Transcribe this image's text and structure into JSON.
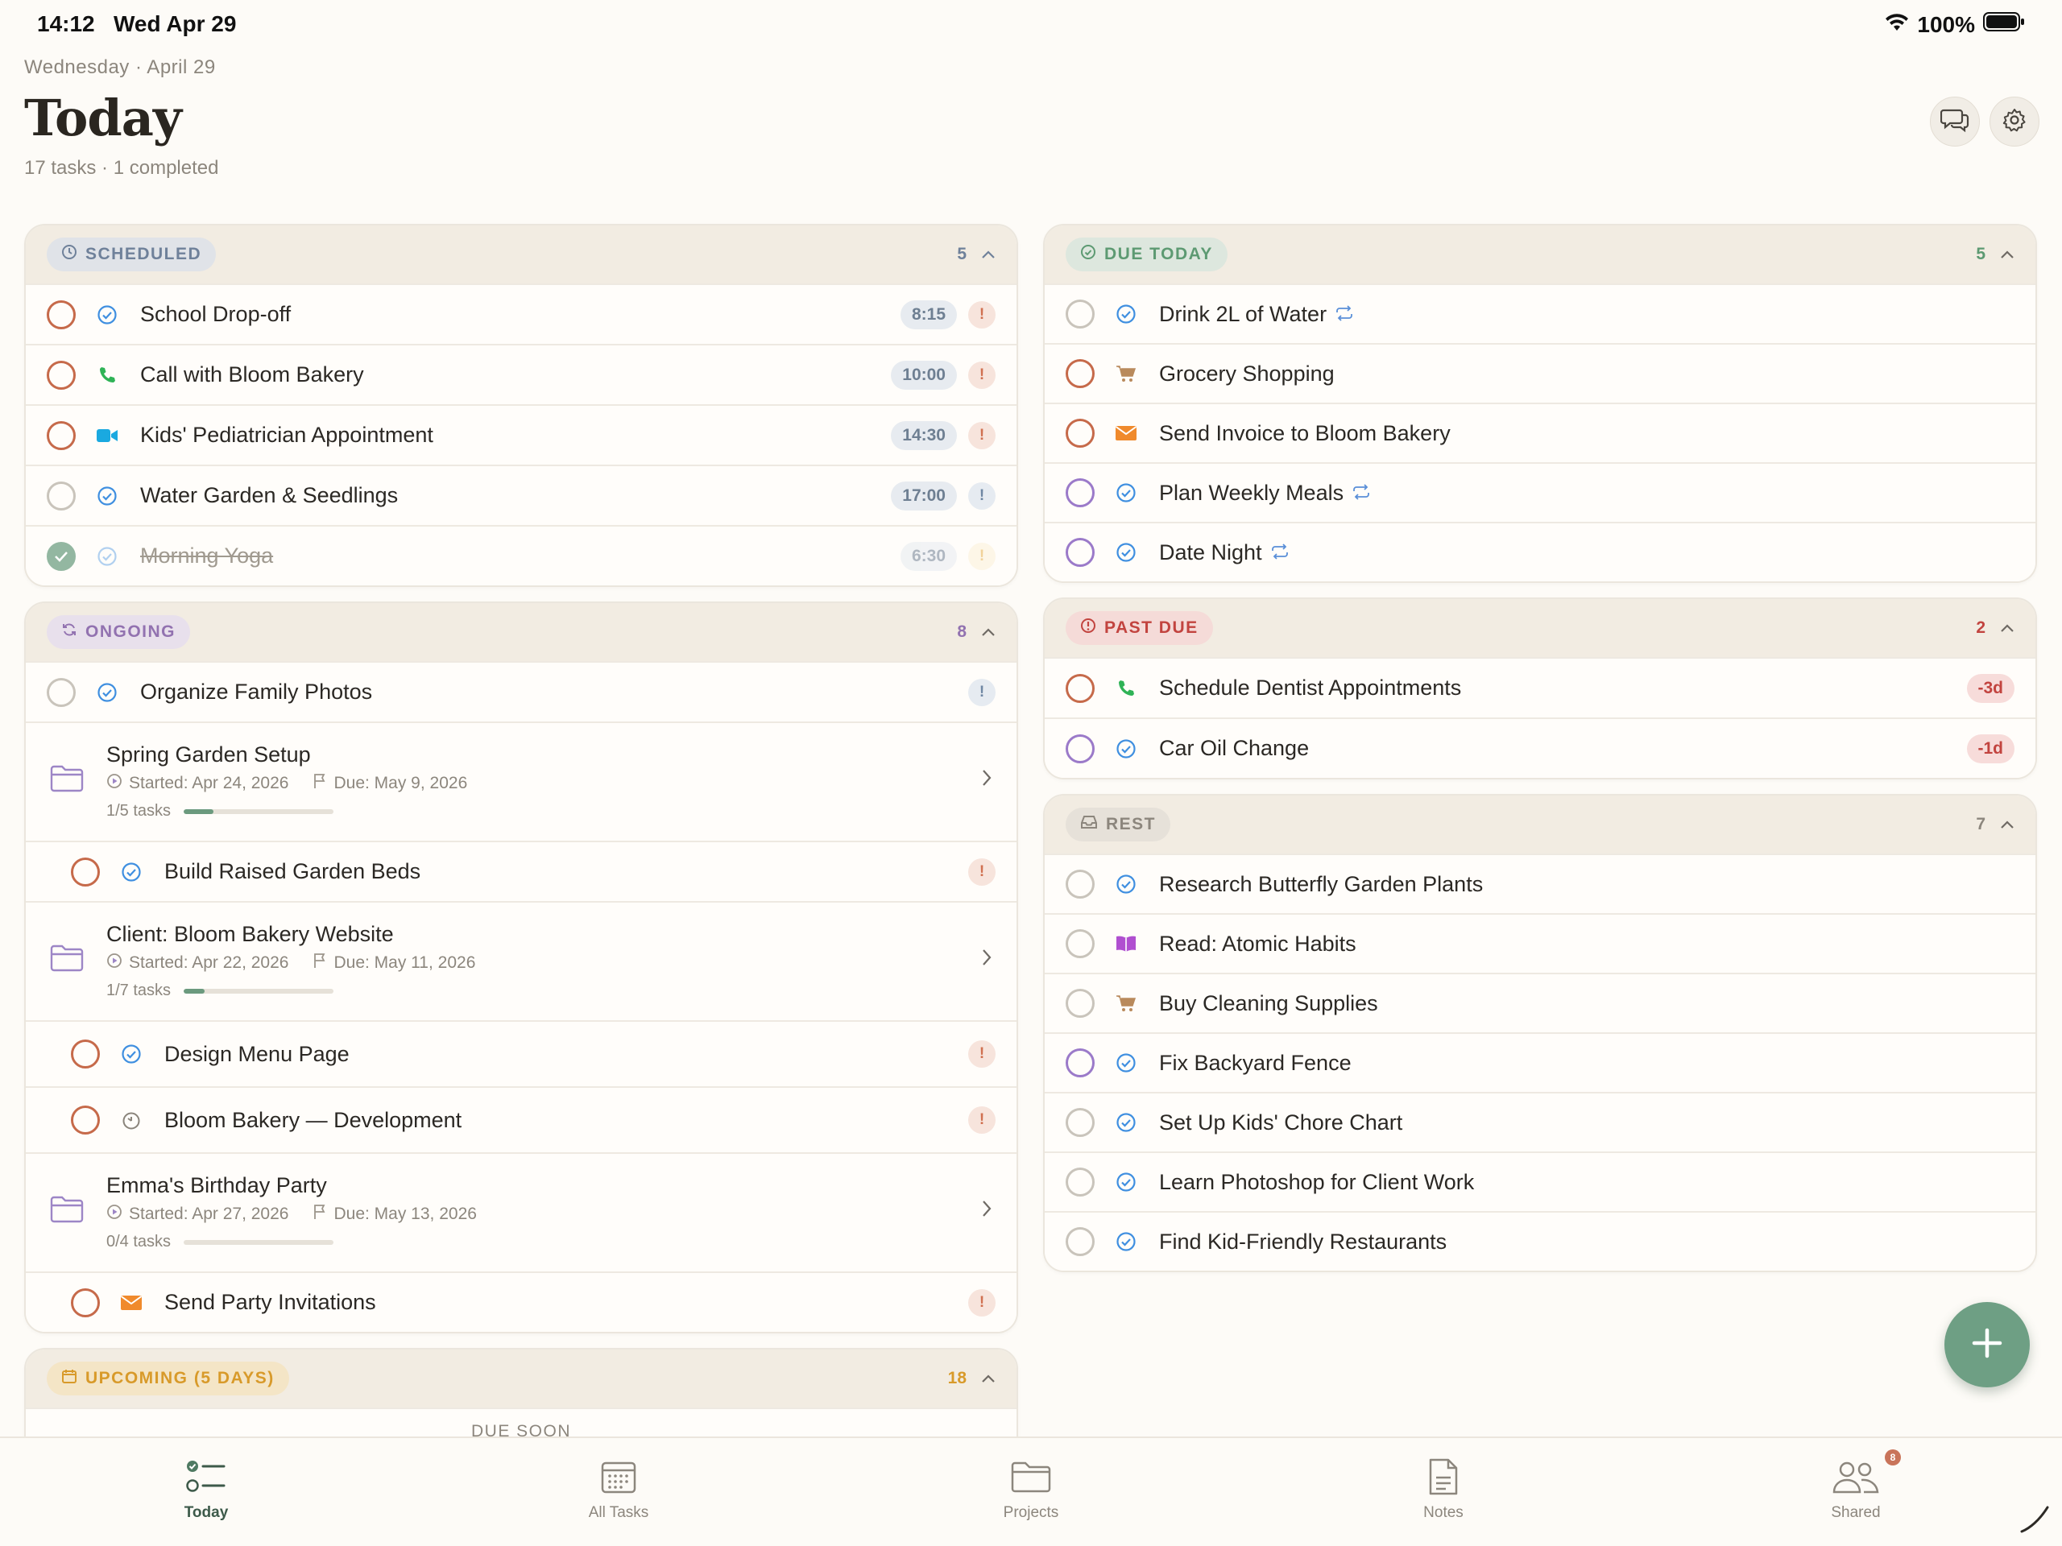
{
  "status_bar": {
    "time": "14:12",
    "date": "Wed Apr 29",
    "battery": "100%"
  },
  "header": {
    "date": "Wednesday · April 29",
    "title": "Today",
    "subtitle": "17 tasks · 1 completed"
  },
  "sections": {
    "scheduled": {
      "title": "SCHEDULED",
      "count": "5",
      "tasks": [
        {
          "label": "School Drop-off",
          "time": "8:15",
          "icon": "check-badge-icon"
        },
        {
          "label": "Call with Bloom Bakery",
          "time": "10:00",
          "icon": "phone-icon"
        },
        {
          "label": "Kids' Pediatrician Appointment",
          "time": "14:30",
          "icon": "video-icon"
        },
        {
          "label": "Water Garden & Seedlings",
          "time": "17:00",
          "icon": "check-badge-icon"
        },
        {
          "label": "Morning Yoga",
          "time": "6:30",
          "icon": "check-badge-icon",
          "completed": true
        }
      ]
    },
    "ongoing": {
      "title": "ONGOING",
      "count": "8",
      "task0": {
        "label": "Organize Family Photos"
      },
      "projects": [
        {
          "name": "Spring Garden Setup",
          "started": "Started: Apr 24, 2026",
          "due": "Due: May 9, 2026",
          "progress_text": "1/5 tasks",
          "progress": 0.2
        },
        {
          "name": "Client: Bloom Bakery Website",
          "started": "Started: Apr 22, 2026",
          "due": "Due: May 11, 2026",
          "progress_text": "1/7 tasks",
          "progress": 0.14
        },
        {
          "name": "Emma's Birthday Party",
          "started": "Started: Apr 27, 2026",
          "due": "Due: May 13, 2026",
          "progress_text": "0/4 tasks",
          "progress": 0
        }
      ],
      "subtasks": [
        {
          "label": "Build Raised Garden Beds"
        },
        {
          "label": "Design Menu Page"
        },
        {
          "label": "Bloom Bakery — Development"
        },
        {
          "label": "Send Party Invitations"
        }
      ]
    },
    "upcoming": {
      "title": "UPCOMING (5 DAYS)",
      "count": "18",
      "group": "DUE SOON"
    },
    "due_today": {
      "title": "DUE TODAY",
      "count": "5",
      "tasks": [
        {
          "label": "Drink 2L of Water",
          "repeat": true
        },
        {
          "label": "Grocery Shopping"
        },
        {
          "label": "Send Invoice to Bloom Bakery"
        },
        {
          "label": "Plan Weekly Meals",
          "repeat": true
        },
        {
          "label": "Date Night",
          "repeat": true
        }
      ]
    },
    "past_due": {
      "title": "PAST DUE",
      "count": "2",
      "tasks": [
        {
          "label": "Schedule Dentist Appointments",
          "overdue": "-3d"
        },
        {
          "label": "Car Oil Change",
          "overdue": "-1d"
        }
      ]
    },
    "rest": {
      "title": "REST",
      "count": "7",
      "tasks": [
        {
          "label": "Research Butterfly Garden Plants"
        },
        {
          "label": "Read: Atomic Habits"
        },
        {
          "label": "Buy Cleaning Supplies"
        },
        {
          "label": "Fix Backyard Fence"
        },
        {
          "label": "Set Up Kids' Chore Chart"
        },
        {
          "label": "Learn Photoshop for Client Work"
        },
        {
          "label": "Find Kid-Friendly Restaurants"
        }
      ]
    }
  },
  "tabs": [
    {
      "label": "Today"
    },
    {
      "label": "All Tasks"
    },
    {
      "label": "Projects"
    },
    {
      "label": "Notes"
    },
    {
      "label": "Shared",
      "badge": "8"
    }
  ],
  "colors": {
    "accent": "#6e9f84",
    "priority": "#d07050",
    "overdue": "#c2443f"
  }
}
